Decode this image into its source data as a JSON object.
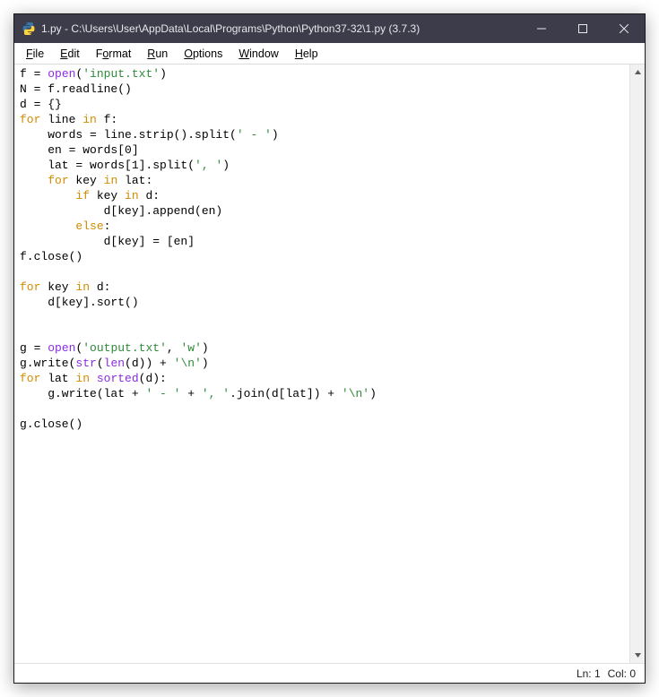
{
  "window": {
    "title": "1.py - C:\\Users\\User\\AppData\\Local\\Programs\\Python\\Python37-32\\1.py (3.7.3)"
  },
  "menu": {
    "items": [
      {
        "pre": "",
        "accel": "F",
        "post": "ile"
      },
      {
        "pre": "",
        "accel": "E",
        "post": "dit"
      },
      {
        "pre": "F",
        "accel": "o",
        "post": "rmat"
      },
      {
        "pre": "",
        "accel": "R",
        "post": "un"
      },
      {
        "pre": "",
        "accel": "O",
        "post": "ptions"
      },
      {
        "pre": "",
        "accel": "W",
        "post": "indow"
      },
      {
        "pre": "",
        "accel": "H",
        "post": "elp"
      }
    ]
  },
  "code": [
    [
      {
        "t": "plain",
        "v": "f = "
      },
      {
        "t": "builtin",
        "v": "open"
      },
      {
        "t": "plain",
        "v": "("
      },
      {
        "t": "str",
        "v": "'input.txt'"
      },
      {
        "t": "plain",
        "v": ")"
      }
    ],
    [
      {
        "t": "plain",
        "v": "N = f.readline()"
      }
    ],
    [
      {
        "t": "plain",
        "v": "d = {}"
      }
    ],
    [
      {
        "t": "kw",
        "v": "for"
      },
      {
        "t": "plain",
        "v": " line "
      },
      {
        "t": "kw",
        "v": "in"
      },
      {
        "t": "plain",
        "v": " f:"
      }
    ],
    [
      {
        "t": "plain",
        "v": "    words = line.strip().split("
      },
      {
        "t": "str",
        "v": "' - '"
      },
      {
        "t": "plain",
        "v": ")"
      }
    ],
    [
      {
        "t": "plain",
        "v": "    en = words[0]"
      }
    ],
    [
      {
        "t": "plain",
        "v": "    lat = words[1].split("
      },
      {
        "t": "str",
        "v": "', '"
      },
      {
        "t": "plain",
        "v": ")"
      }
    ],
    [
      {
        "t": "plain",
        "v": "    "
      },
      {
        "t": "kw",
        "v": "for"
      },
      {
        "t": "plain",
        "v": " key "
      },
      {
        "t": "kw",
        "v": "in"
      },
      {
        "t": "plain",
        "v": " lat:"
      }
    ],
    [
      {
        "t": "plain",
        "v": "        "
      },
      {
        "t": "kw",
        "v": "if"
      },
      {
        "t": "plain",
        "v": " key "
      },
      {
        "t": "kw",
        "v": "in"
      },
      {
        "t": "plain",
        "v": " d:"
      }
    ],
    [
      {
        "t": "plain",
        "v": "            d[key].append(en)"
      }
    ],
    [
      {
        "t": "plain",
        "v": "        "
      },
      {
        "t": "kw",
        "v": "else"
      },
      {
        "t": "plain",
        "v": ":"
      }
    ],
    [
      {
        "t": "plain",
        "v": "            d[key] = [en]"
      }
    ],
    [
      {
        "t": "plain",
        "v": "f.close()"
      }
    ],
    [
      {
        "t": "plain",
        "v": ""
      }
    ],
    [
      {
        "t": "kw",
        "v": "for"
      },
      {
        "t": "plain",
        "v": " key "
      },
      {
        "t": "kw",
        "v": "in"
      },
      {
        "t": "plain",
        "v": " d:"
      }
    ],
    [
      {
        "t": "plain",
        "v": "    d[key].sort()"
      }
    ],
    [
      {
        "t": "plain",
        "v": ""
      }
    ],
    [
      {
        "t": "plain",
        "v": ""
      }
    ],
    [
      {
        "t": "plain",
        "v": "g = "
      },
      {
        "t": "builtin",
        "v": "open"
      },
      {
        "t": "plain",
        "v": "("
      },
      {
        "t": "str",
        "v": "'output.txt'"
      },
      {
        "t": "plain",
        "v": ", "
      },
      {
        "t": "str",
        "v": "'w'"
      },
      {
        "t": "plain",
        "v": ")"
      }
    ],
    [
      {
        "t": "plain",
        "v": "g.write("
      },
      {
        "t": "builtin",
        "v": "str"
      },
      {
        "t": "plain",
        "v": "("
      },
      {
        "t": "builtin",
        "v": "len"
      },
      {
        "t": "plain",
        "v": "(d)) + "
      },
      {
        "t": "str",
        "v": "'\\n'"
      },
      {
        "t": "plain",
        "v": ")"
      }
    ],
    [
      {
        "t": "kw",
        "v": "for"
      },
      {
        "t": "plain",
        "v": " lat "
      },
      {
        "t": "kw",
        "v": "in"
      },
      {
        "t": "plain",
        "v": " "
      },
      {
        "t": "builtin",
        "v": "sorted"
      },
      {
        "t": "plain",
        "v": "(d):"
      }
    ],
    [
      {
        "t": "plain",
        "v": "    g.write(lat + "
      },
      {
        "t": "str",
        "v": "' - '"
      },
      {
        "t": "plain",
        "v": " + "
      },
      {
        "t": "str",
        "v": "', '"
      },
      {
        "t": "plain",
        "v": ".join(d[lat]) + "
      },
      {
        "t": "str",
        "v": "'\\n'"
      },
      {
        "t": "plain",
        "v": ")"
      }
    ],
    [
      {
        "t": "plain",
        "v": ""
      }
    ],
    [
      {
        "t": "plain",
        "v": "g.close()"
      }
    ]
  ],
  "status": {
    "ln": "Ln: 1",
    "col": "Col: 0"
  }
}
